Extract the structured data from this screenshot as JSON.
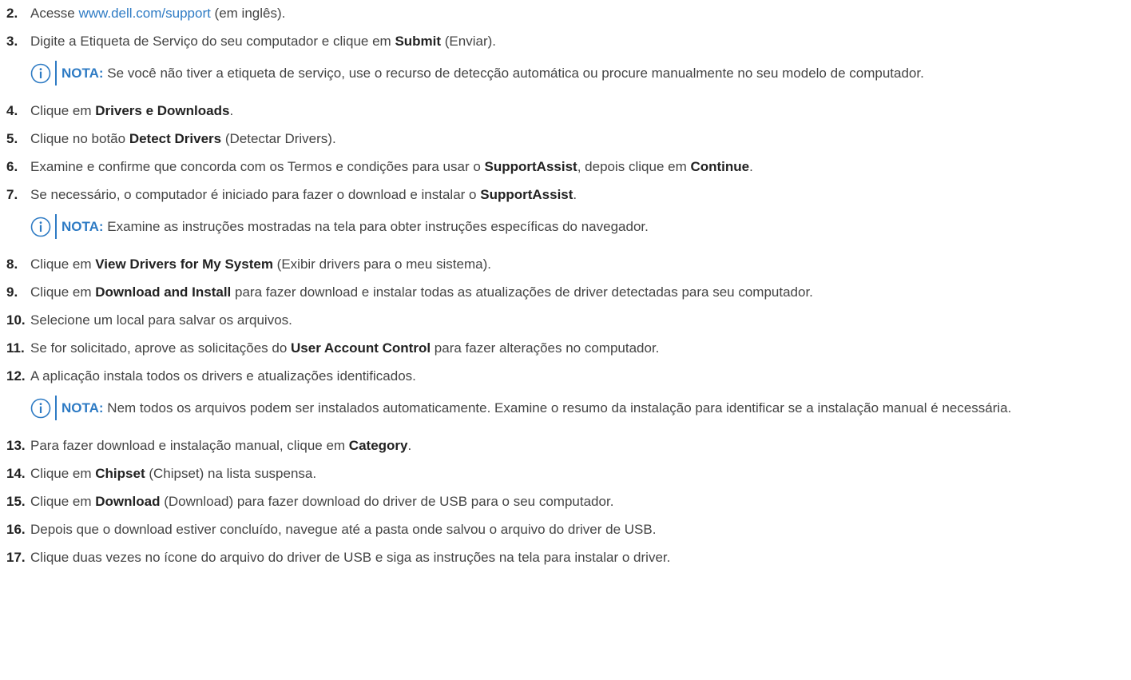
{
  "accent_color": "#2e7bc4",
  "text_color": "#444444",
  "note_label": "NOTA:",
  "steps": [
    {
      "num": "2.",
      "a": "Acesse ",
      "link": "www.dell.com/support",
      "b": " (em inglês)."
    },
    {
      "num": "3.",
      "a": "Digite a Etiqueta de Serviço do seu computador e clique em ",
      "bold": "Submit",
      "b": " (Enviar)."
    },
    {
      "num": "4.",
      "a": "Clique em ",
      "bold": "Drivers e Downloads",
      "b": "."
    },
    {
      "num": "5.",
      "a": "Clique no botão ",
      "bold": "Detect Drivers",
      "b": " (Detectar Drivers)."
    },
    {
      "num": "6.",
      "a": "Examine e confirme que concorda com os Termos e condições para usar o ",
      "bold": "SupportAssist",
      "b": ", depois clique em ",
      "bold2": "Continue",
      "c": "."
    },
    {
      "num": "7.",
      "a": "Se necessário, o computador é iniciado para fazer o download e instalar o ",
      "bold": "SupportAssist",
      "b": "."
    },
    {
      "num": "8.",
      "a": "Clique em ",
      "bold": "View Drivers for My System",
      "b": " (Exibir drivers para o meu sistema)."
    },
    {
      "num": "9.",
      "a": "Clique em ",
      "bold": "Download and Install",
      "b": " para fazer download e instalar todas as atualizações de driver detectadas para seu computador."
    },
    {
      "num": "10.",
      "a": "Selecione um local para salvar os arquivos."
    },
    {
      "num": "11.",
      "a": "Se for solicitado, aprove as solicitações do ",
      "bold": "User Account Control",
      "b": " para fazer alterações no computador."
    },
    {
      "num": "12.",
      "a": "A aplicação instala todos os drivers e atualizações identificados."
    },
    {
      "num": "13.",
      "a": "Para fazer download e instalação manual, clique em ",
      "bold": "Category",
      "b": "."
    },
    {
      "num": "14.",
      "a": "Clique em ",
      "bold": "Chipset",
      "b": " (Chipset) na lista suspensa."
    },
    {
      "num": "15.",
      "a": "Clique em ",
      "bold": "Download",
      "b": " (Download) para fazer download do driver de USB para o seu computador."
    },
    {
      "num": "16.",
      "a": "Depois que o download estiver concluído, navegue até a pasta onde salvou o arquivo do driver de USB."
    },
    {
      "num": "17.",
      "a": "Clique duas vezes no ícone do arquivo do driver de USB e siga as instruções na tela para instalar o driver."
    }
  ],
  "notes": [
    {
      "text": "Se você não tiver a etiqueta de serviço, use o recurso de detecção automática ou procure manualmente no seu modelo de computador."
    },
    {
      "text": "Examine as instruções mostradas na tela para obter instruções específicas do navegador."
    },
    {
      "text": "Nem todos os arquivos podem ser instalados automaticamente. Examine o resumo da instalação para identificar se a instalação manual é necessária."
    }
  ]
}
